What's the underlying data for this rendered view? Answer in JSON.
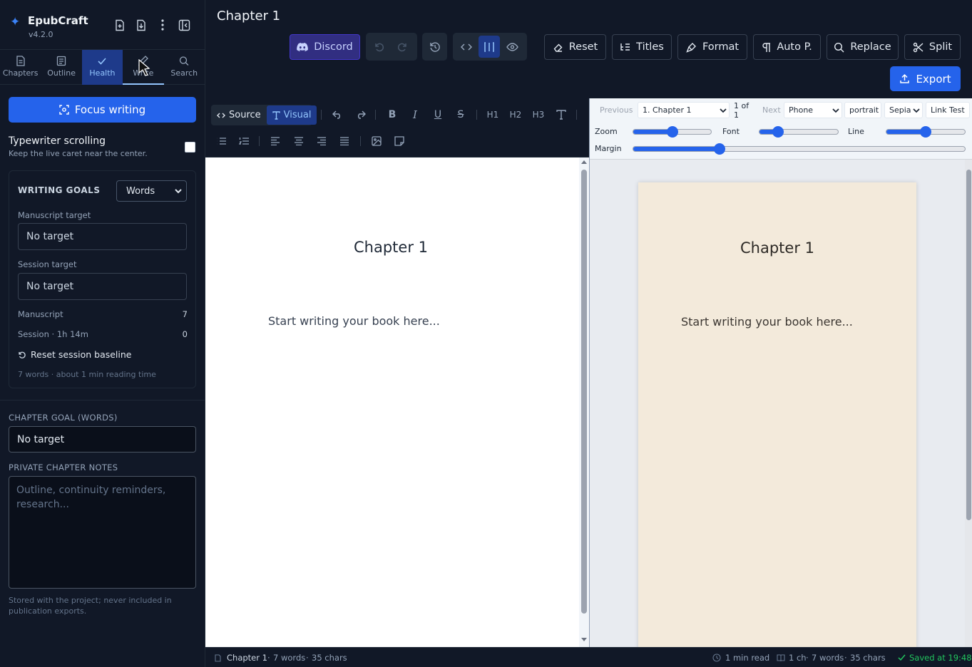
{
  "app": {
    "name": "EpubCraft",
    "version": "v4.2.0"
  },
  "sidebar": {
    "tabs": [
      {
        "label": "Chapters",
        "icon": "file-icon"
      },
      {
        "label": "Outline",
        "icon": "outline-icon"
      },
      {
        "label": "Health",
        "icon": "check-icon"
      },
      {
        "label": "Write",
        "icon": "pen-icon"
      },
      {
        "label": "Search",
        "icon": "search-icon"
      }
    ],
    "focus_label": "Focus writing",
    "typewriter": {
      "label": "Typewriter scrolling",
      "sub": "Keep the live caret near the center.",
      "checked": false
    },
    "goals": {
      "heading": "WRITING GOALS",
      "unit": "Words",
      "manuscript_target_label": "Manuscript target",
      "manuscript_target_placeholder": "No target",
      "session_target_label": "Session target",
      "session_target_placeholder": "No target",
      "manuscript_label": "Manuscript",
      "manuscript_value": "7",
      "session_label": "Session · 1h 14m",
      "session_value": "0",
      "reset_label": "Reset session baseline",
      "summary": "7 words · about 1 min reading time"
    },
    "chapter_goal_label": "CHAPTER GOAL (WORDS)",
    "chapter_goal_placeholder": "No target",
    "notes_label": "PRIVATE CHAPTER NOTES",
    "notes_placeholder": "Outline, continuity reminders, research...",
    "notes_footer": "Stored with the project; never included in publication exports."
  },
  "header": {
    "title": "Chapter 1",
    "discord": "Discord",
    "actions": [
      "Reset",
      "Titles",
      "Format",
      "Auto P.",
      "Replace",
      "Split"
    ],
    "export": "Export"
  },
  "editor": {
    "source_label": "Source",
    "visual_label": "Visual",
    "heading_buttons": [
      "H1",
      "H2",
      "H3"
    ],
    "chapter_heading": "Chapter 1",
    "body_text": "Start writing your book here..."
  },
  "preview": {
    "prev": "Previous",
    "chapter_select": "1. Chapter 1",
    "page_info": "1 of 1",
    "next": "Next",
    "device": "Phone",
    "orientation": "portrait",
    "theme": "Sepia",
    "link_test": "Link Test",
    "sliders": [
      {
        "label": "Zoom",
        "value": 0.5
      },
      {
        "label": "Font",
        "value": 0.24
      },
      {
        "label": "Line",
        "value": 0.5
      },
      {
        "label": "Margin",
        "value": 0.26
      }
    ],
    "chapter_heading": "Chapter 1",
    "body_text": "Start writing your book here..."
  },
  "status": {
    "chapter": "Chapter 1",
    "words": "7 words",
    "chars": "35 chars",
    "read": "1 min read",
    "ch": "1 ch",
    "words2": "7 words",
    "chars2": "35 chars",
    "saved": "Saved at 19:48"
  },
  "colors": {
    "accent": "#2563eb",
    "discord": "#312e81",
    "sepia_page": "#f3eadb",
    "saved": "#22c55e"
  }
}
